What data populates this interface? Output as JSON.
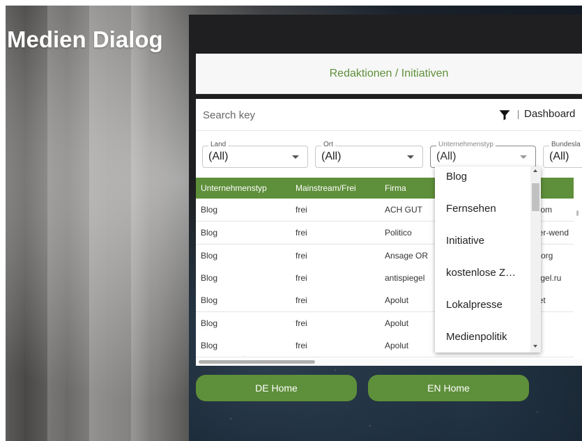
{
  "app": {
    "title": "Medien Dialog"
  },
  "panel": {
    "header_title": "Redaktionen / Initiativen"
  },
  "search": {
    "placeholder": "Search key",
    "dashboard_label": "Dashboard"
  },
  "filters": [
    {
      "label": "Land",
      "value": "(All)"
    },
    {
      "label": "Ort",
      "value": "(All)"
    },
    {
      "label": "Unternehmenstyp",
      "value": "(All)"
    },
    {
      "label": "Bundesla",
      "value": "(All)"
    }
  ],
  "table": {
    "columns": [
      "Unternehmenstyp",
      "Mainstream/Frei",
      "Firma"
    ],
    "rows": [
      [
        "Blog",
        "frei",
        "ACH GUT",
        ".com"
      ],
      [
        "Blog",
        "frei",
        "Politico",
        "der-wend"
      ],
      [
        "Blog",
        "frei",
        "Ansage OR",
        "e.org"
      ],
      [
        "Blog",
        "frei",
        "antispiegel",
        "iegel.ru"
      ],
      [
        "Blog",
        "frei",
        "Apolut",
        "net"
      ],
      [
        "Blog",
        "frei",
        "Apolut",
        ""
      ],
      [
        "Blog",
        "frei",
        "Apolut",
        ""
      ]
    ]
  },
  "dropdown": {
    "options": [
      "Blog",
      "Fernsehen",
      "Initiative",
      "kostenlose Z…",
      "Lokalpresse",
      "Medienpolitik"
    ]
  },
  "buttons": {
    "de_home": "DE Home",
    "en_home": "EN Home"
  },
  "colors": {
    "accent": "#5e8f3a",
    "panel_dark": "#1f1f21",
    "header_bg": "#f7f7f7"
  }
}
